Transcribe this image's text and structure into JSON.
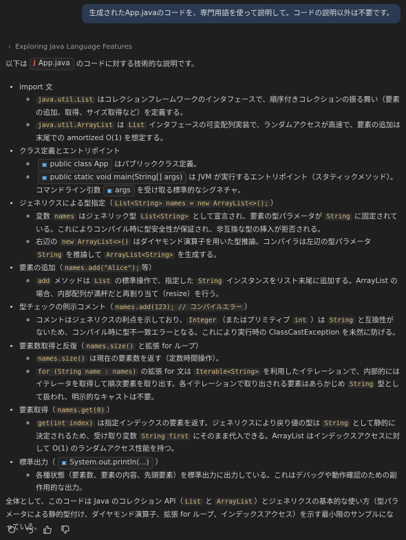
{
  "user_message": "生成されたApp.javaのコードを、専門用語を使って説明して。コードの説明以外は不要です。",
  "thinking_label": "Exploring Java Language Features",
  "intro": {
    "before": "以下は",
    "file_chip": "App.java",
    "after": "のコードに対する技術的な説明です。"
  },
  "sections": {
    "imp": {
      "title": "import 文",
      "i1": {
        "code": "java.util.List",
        "text": "はコレクションフレームワークのインタフェースで、順序付きコレクションの振る舞い（要素の追加、取得、サイズ取得など）を定義する。"
      },
      "i2": {
        "code1": "java.util.ArrayList",
        "t1": "は",
        "code2": "List",
        "t2": "インタフェースの可変配列実装で、ランダムアクセスが高速で、要素の追加は末尾での amortized O(1) を想定する。"
      }
    },
    "cls": {
      "title": "クラス定義とエントリポイント",
      "i1": {
        "chip": "public class App",
        "text": "はパブリッククラス定義。"
      },
      "i2": {
        "chip": "public static void main(String[] args)",
        "t1": "は JVM が実行するエントリポイント（スタティックメソッド）。コマンドライン引数",
        "chip2": "args",
        "t2": "を受け取る標準的なシグネチャ。"
      }
    },
    "gen": {
      "t1": "ジェネリクスによる型指定（",
      "code": "List<String> names = new ArrayList<>();",
      "t2": "）",
      "i1": {
        "t1": "変数",
        "code1": "names",
        "t2": "はジェネリック型",
        "code2": "List<String>",
        "t3": "として宣言され、要素の型パラメータが",
        "code3": "String",
        "t4": "に固定されている。これによりコンパイル時に型安全性が保証され、非互換な型の挿入が拒否される。"
      },
      "i2": {
        "t1": "右辺の",
        "code1": "new ArrayList<>()",
        "t2": "はダイヤモンド演算子を用いた型推論。コンパイラは左辺の型パラメータ",
        "code2": "String",
        "t3": "を推論して",
        "code3": "ArrayList<String>",
        "t4": "を生成する。"
      }
    },
    "add": {
      "t1": "要素の追加（",
      "code": "names.add(\"Alice\");",
      "t2": "等）",
      "i1": {
        "code1": "add",
        "t1": "メソッドは",
        "code2": "List",
        "t2": "の標準操作で、指定した",
        "code3": "String",
        "t3": "インスタンスをリスト末尾に追加する。ArrayList の場合、内部配列が満杯だと再割り当て（resize）を行う。"
      }
    },
    "err": {
      "t1": "型チェックの例示コメント（",
      "code": "names.add(123); // コンパイルエラー",
      "t2": "）",
      "i1": {
        "t1": "コメントはジェネリクスの利点を示しており、",
        "code1": "Integer",
        "t2": "（またはプリミティブ",
        "code2": "int",
        "t3": "）は",
        "code3": "String",
        "t4": "と互換性がないため、コンパイル時に型不一致エラーとなる。これにより実行時の ClassCastException を未然に防げる。"
      }
    },
    "loop": {
      "t1": "要素数取得と反復（",
      "code": "names.size()",
      "t2": "と拡張 for ループ）",
      "i1": {
        "code": "names.size()",
        "text": "は現在の要素数を返す（定数時間操作）。"
      },
      "i2": {
        "code1": "for (String name : names)",
        "t1": "の拡張 for 文は",
        "code2": "Iterable<String>",
        "t2": "を利用したイテレーションで、内部的にはイテレータを取得して順次要素を取り出す。各イテレーションで取り出される要素はあらかじめ",
        "code3": "String",
        "t3": "型として扱われ、明示的なキャストは不要。"
      }
    },
    "get": {
      "t1": "要素取得（",
      "code": "names.get(0)",
      "t2": "）",
      "i1": {
        "code1": "get(int index)",
        "t1": "は指定インデックスの要素を返す。ジェネリクスにより戻り値の型は",
        "code2": "String",
        "t2": "として静的に決定されるため、受け取り変数",
        "code3": "String first",
        "t3": "にそのまま代入できる。ArrayList はインデックスアクセスに対して O(1) のランダムアクセス性能を持つ。"
      }
    },
    "out": {
      "t1": "標準出力（",
      "chip": "System.out.println(...)",
      "t2": "）",
      "i1": {
        "text": "各種状態（要素数、要素の内容、先頭要素）を標準出力に出力している。これはデバッグや動作確認のための副作用的な出力。"
      }
    }
  },
  "summary": {
    "t1": "全体として、このコードは Java のコレクション API（",
    "code1": "List",
    "t2": "と",
    "code2": "ArrayList",
    "t3": "）とジェネリクスの基本的な使い方（型パラメータによる静的型付け、ダイヤモンド演算子、拡張 for ループ、インデックスアクセス）を示す最小限のサンプルになっている。"
  },
  "actions": {
    "icons": [
      "retry-icon",
      "undo-icon",
      "thumbs-up-icon",
      "thumbs-down-icon"
    ]
  },
  "colors": {
    "background": "#1f1f1f",
    "user_bubble": "#2b3a52",
    "code_text": "#d7ba7d",
    "code_bg": "#2d2d2d",
    "symbol_icon": "#75beff",
    "java_icon": "#e05d44"
  }
}
